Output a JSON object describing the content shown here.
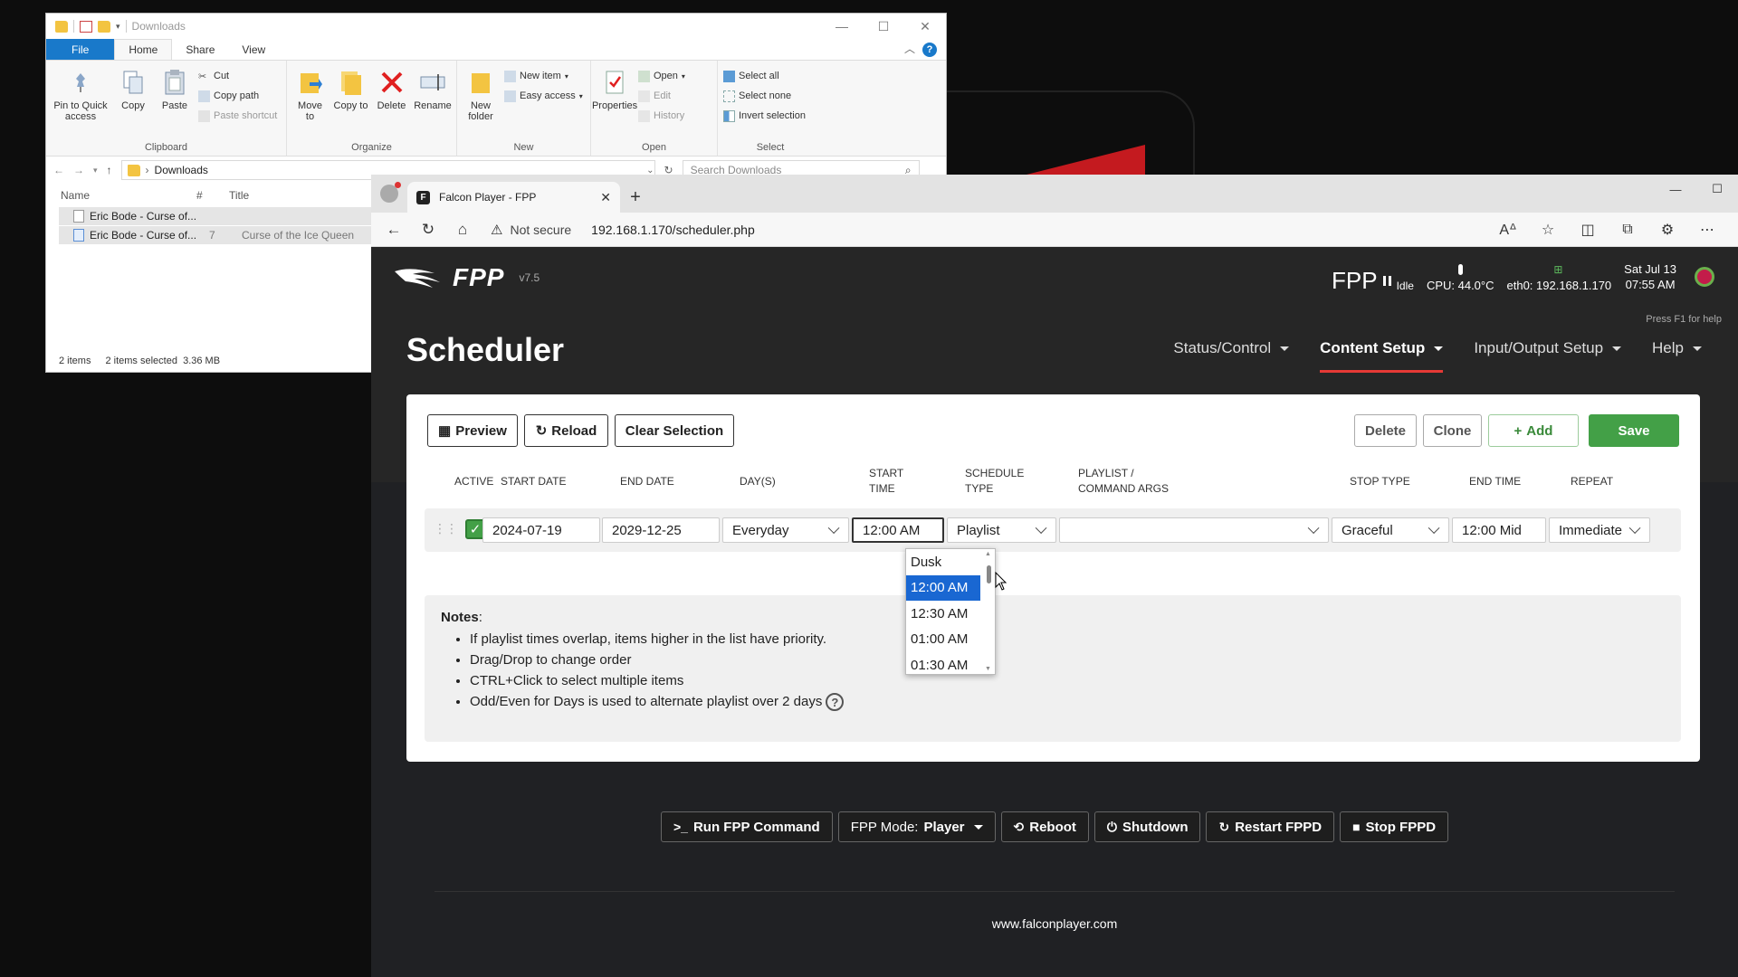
{
  "explorer": {
    "title": "Downloads",
    "tabs": [
      "File",
      "Home",
      "Share",
      "View"
    ],
    "ribbon": {
      "clipboard": {
        "label": "Clipboard",
        "pin": "Pin to Quick access",
        "copy": "Copy",
        "paste": "Paste",
        "cut": "Cut",
        "copy_path": "Copy path",
        "paste_shortcut": "Paste shortcut"
      },
      "organize": {
        "label": "Organize",
        "move_to": "Move to",
        "copy_to": "Copy to",
        "delete": "Delete",
        "rename": "Rename"
      },
      "new": {
        "label": "New",
        "new_folder": "New folder",
        "new_item": "New item",
        "easy_access": "Easy access"
      },
      "open": {
        "label": "Open",
        "properties": "Properties",
        "open": "Open",
        "edit": "Edit",
        "history": "History"
      },
      "select": {
        "label": "Select",
        "select_all": "Select all",
        "select_none": "Select none",
        "invert": "Invert selection"
      }
    },
    "address": "Downloads",
    "search_placeholder": "Search Downloads",
    "columns": {
      "name": "Name",
      "num": "#",
      "title": "Title"
    },
    "files": [
      {
        "name": "Eric Bode - Curse of...",
        "num": "",
        "title": ""
      },
      {
        "name": "Eric Bode - Curse of...",
        "num": "7",
        "title": "Curse of the Ice Queen"
      }
    ],
    "status": {
      "items": "2 items",
      "selected": "2 items selected",
      "size": "3.36 MB"
    }
  },
  "browser": {
    "tab_title": "Falcon Player - FPP",
    "security": "Not secure",
    "url": "192.168.1.170/scheduler.php"
  },
  "fpp": {
    "logo": "FPP",
    "version": "v7.5",
    "status_label": "FPP",
    "status_state": "Idle",
    "cpu": "CPU: 44.0°C",
    "ip": "eth0: 192.168.1.170",
    "date": "Sat Jul 13",
    "time": "07:55 AM",
    "help_hint": "Press F1 for help",
    "page_title": "Scheduler",
    "menu": [
      "Status/Control",
      "Content Setup",
      "Input/Output Setup",
      "Help"
    ],
    "toolbar": {
      "preview": "Preview",
      "reload": "Reload",
      "clear": "Clear Selection",
      "delete": "Delete",
      "clone": "Clone",
      "add": "Add",
      "save": "Save"
    },
    "headers": {
      "active": "ACTIVE",
      "start_date": "START DATE",
      "end_date": "END DATE",
      "days": "DAY(S)",
      "start_time_1": "START",
      "start_time_2": "TIME",
      "sched_type_1": "SCHEDULE",
      "sched_type_2": "TYPE",
      "playlist_1": "PLAYLIST /",
      "playlist_2": "COMMAND ARGS",
      "stop_type": "STOP TYPE",
      "end_time": "END TIME",
      "repeat": "REPEAT"
    },
    "row": {
      "start_date": "2024-07-19",
      "end_date": "2029-12-25",
      "days": "Everyday",
      "start_time": "12:00 AM",
      "schedule_type": "Playlist",
      "playlist": "",
      "stop_type": "Graceful",
      "end_time": "12:00 Mid",
      "repeat": "Immediate"
    },
    "time_options": [
      "Dusk",
      "12:00 AM",
      "12:30 AM",
      "01:00 AM",
      "01:30 AM"
    ],
    "notes_title": "Notes",
    "notes": [
      "If playlist times overlap, items higher in the list have priority.",
      "Drag/Drop to change order",
      "CTRL+Click to select multiple items",
      "Odd/Even for Days is used to alternate playlist over 2 days"
    ],
    "footer": {
      "run_cmd": "Run FPP Command",
      "mode_label": "FPP Mode:",
      "mode_value": "Player",
      "reboot": "Reboot",
      "shutdown": "Shutdown",
      "restart": "Restart FPPD",
      "stop": "Stop FPPD"
    },
    "site": "www.falconplayer.com"
  },
  "colors": {
    "accent_green": "#43a047",
    "menu_underline": "#e53935",
    "selection_blue": "#1967d2",
    "explorer_blue": "#1979ca"
  }
}
